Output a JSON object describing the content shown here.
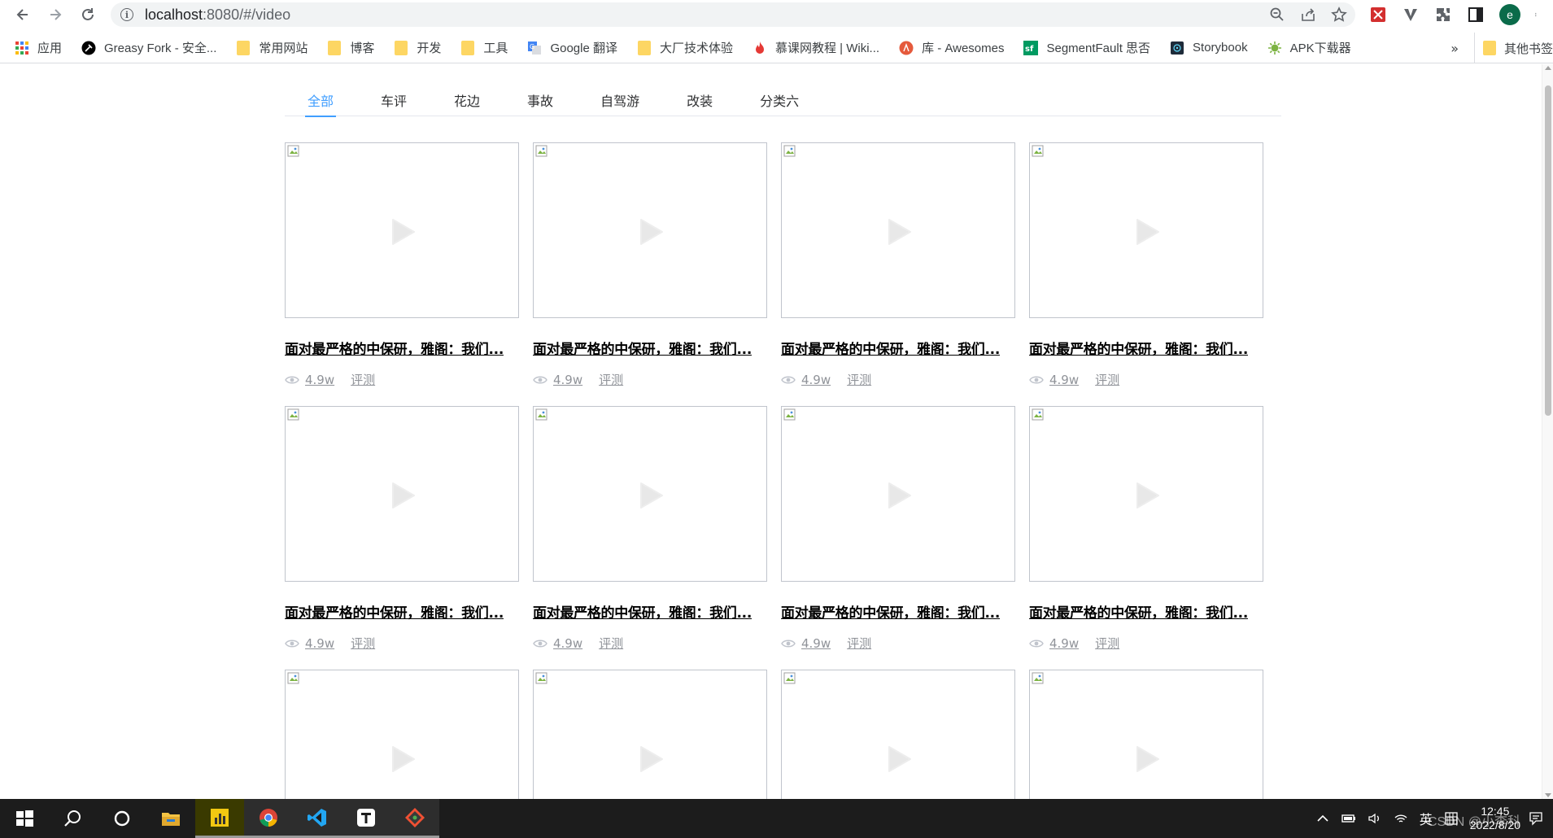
{
  "browser": {
    "url_host": "localhost",
    "url_path": ":8080/#/video",
    "avatar_letter": "e"
  },
  "bookmarks": {
    "items": [
      {
        "label": "应用",
        "icon": "apps-grid-icon"
      },
      {
        "label": "Greasy Fork - 安全...",
        "icon": "greasyfork-icon"
      },
      {
        "label": "常用网站",
        "icon": "folder-icon"
      },
      {
        "label": "博客",
        "icon": "folder-icon"
      },
      {
        "label": "开发",
        "icon": "folder-icon"
      },
      {
        "label": "工具",
        "icon": "folder-icon"
      },
      {
        "label": "Google 翻译",
        "icon": "google-translate-icon"
      },
      {
        "label": "大厂技术体验",
        "icon": "folder-icon"
      },
      {
        "label": "慕课网教程 | Wiki...",
        "icon": "flame-icon"
      },
      {
        "label": "库 - Awesomes",
        "icon": "awesomes-icon"
      },
      {
        "label": "SegmentFault 思否",
        "icon": "segmentfault-icon"
      },
      {
        "label": "Storybook",
        "icon": "storybook-icon"
      },
      {
        "label": "APK下载器",
        "icon": "android-icon"
      }
    ],
    "more": "»",
    "other": "其他书签"
  },
  "tabs": [
    {
      "label": "全部",
      "active": true
    },
    {
      "label": "车评",
      "active": false
    },
    {
      "label": "花边",
      "active": false
    },
    {
      "label": "事故",
      "active": false
    },
    {
      "label": "自驾游",
      "active": false
    },
    {
      "label": "改装",
      "active": false
    },
    {
      "label": "分类六",
      "active": false
    }
  ],
  "videos": [
    {
      "title": "面对最严格的中保研，雅阁：我们...",
      "views": "4.9w",
      "tag": "评测"
    },
    {
      "title": "面对最严格的中保研，雅阁：我们...",
      "views": "4.9w",
      "tag": "评测"
    },
    {
      "title": "面对最严格的中保研，雅阁：我们...",
      "views": "4.9w",
      "tag": "评测"
    },
    {
      "title": "面对最严格的中保研，雅阁：我们...",
      "views": "4.9w",
      "tag": "评测"
    },
    {
      "title": "面对最严格的中保研，雅阁：我们...",
      "views": "4.9w",
      "tag": "评测"
    },
    {
      "title": "面对最严格的中保研，雅阁：我们...",
      "views": "4.9w",
      "tag": "评测"
    },
    {
      "title": "面对最严格的中保研，雅阁：我们...",
      "views": "4.9w",
      "tag": "评测"
    },
    {
      "title": "面对最严格的中保研，雅阁：我们...",
      "views": "4.9w",
      "tag": "评测"
    },
    {
      "title": "",
      "views": "",
      "tag": ""
    },
    {
      "title": "",
      "views": "",
      "tag": ""
    },
    {
      "title": "",
      "views": "",
      "tag": ""
    },
    {
      "title": "",
      "views": "",
      "tag": ""
    }
  ],
  "taskbar": {
    "time": "12:45",
    "date": "2022/8/20",
    "ime": "英",
    "watermark": "CSDN @小李科"
  },
  "colors": {
    "accent": "#409eff",
    "taskbar": "#1c1c1c"
  }
}
